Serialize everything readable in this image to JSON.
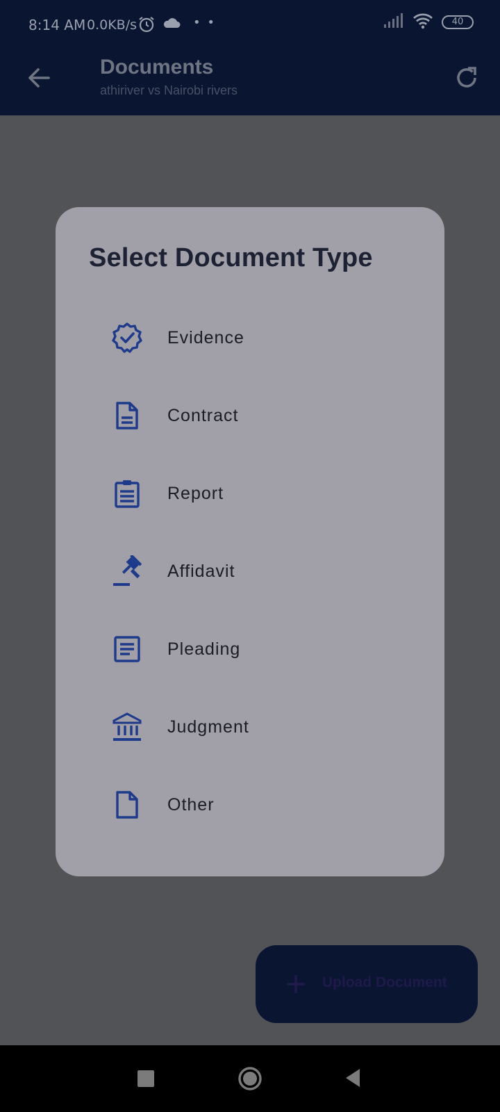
{
  "status_bar": {
    "time": "8:14 AM",
    "speed": "0.0KB/s",
    "battery": "40",
    "icons": [
      "alarm-icon",
      "cloud-icon",
      "signal-icon",
      "wifi-icon",
      "battery-icon"
    ]
  },
  "app_bar": {
    "title": "Documents",
    "subtitle": "athiriver vs Nairobi rivers",
    "back_icon": "arrow-back-icon",
    "refresh_icon": "refresh-icon"
  },
  "dialog": {
    "title": "Select Document Type",
    "options": [
      {
        "label": "Evidence",
        "icon": "verified-badge-icon"
      },
      {
        "label": "Contract",
        "icon": "description-icon"
      },
      {
        "label": "Report",
        "icon": "clipboard-icon"
      },
      {
        "label": "Affidavit",
        "icon": "gavel-icon"
      },
      {
        "label": "Pleading",
        "icon": "article-icon"
      },
      {
        "label": "Judgment",
        "icon": "courthouse-icon"
      },
      {
        "label": "Other",
        "icon": "file-icon"
      }
    ]
  },
  "fab": {
    "label": "Upload Document",
    "icon": "plus-icon"
  },
  "colors": {
    "app_bar": "#0a1532",
    "scrim": "#525356",
    "dialog": "#a19fa7",
    "icon_accent": "#1e3a8a",
    "text_dark": "#1a1d26"
  }
}
